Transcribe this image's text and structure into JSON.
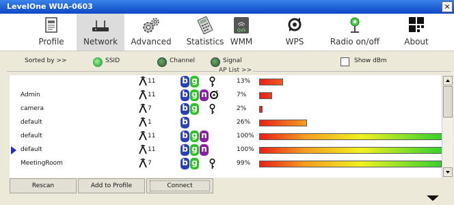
{
  "window": {
    "title": "LevelOne WUA-0603",
    "close_glyph": "×"
  },
  "toolbar": {
    "items": [
      {
        "label": "Profile",
        "icon": "profile-icon"
      },
      {
        "label": "Network",
        "icon": "network-icon",
        "active": true
      },
      {
        "label": "Advanced",
        "icon": "gears-icon"
      },
      {
        "label": "Statistics",
        "icon": "calculator-icon"
      },
      {
        "label": "WMM",
        "icon": "qos-icon",
        "icon_text": "QoS"
      },
      {
        "label": "WPS",
        "icon": "wps-icon"
      },
      {
        "label": "Radio on/off",
        "icon": "radio-icon"
      },
      {
        "label": "About",
        "icon": "about-icon"
      }
    ]
  },
  "sort": {
    "label": "Sorted by >>",
    "options": [
      {
        "label": "SSID",
        "selected": true
      },
      {
        "label": "Channel",
        "selected": false
      },
      {
        "label": "Signal",
        "selected": false
      }
    ],
    "show_dbm": {
      "label": "Show dBm",
      "checked": false
    }
  },
  "ap_list": {
    "header": "AP List >>",
    "rows": [
      {
        "ssid": "",
        "channel": "11",
        "modes": [
          "b",
          "g"
        ],
        "security": "lock",
        "signal": "13%",
        "signal_value": 13
      },
      {
        "ssid": "Admin",
        "channel": "11",
        "modes": [
          "b",
          "g",
          "n"
        ],
        "security": "wps",
        "signal": "7%",
        "signal_value": 7
      },
      {
        "ssid": "camera",
        "channel": "7",
        "modes": [
          "b",
          "g"
        ],
        "security": "lock",
        "signal": "2%",
        "signal_value": 2
      },
      {
        "ssid": "default",
        "channel": "1",
        "modes": [
          "b"
        ],
        "security": "",
        "signal": "26%",
        "signal_value": 26
      },
      {
        "ssid": "default",
        "channel": "11",
        "modes": [
          "b",
          "g",
          "n"
        ],
        "security": "",
        "signal": "100%",
        "signal_value": 100
      },
      {
        "ssid": "default",
        "channel": "11",
        "modes": [
          "b",
          "g",
          "n"
        ],
        "security": "",
        "signal": "100%",
        "signal_value": 100,
        "selected": true
      },
      {
        "ssid": "MeetingRoom",
        "channel": "7",
        "modes": [
          "b",
          "g"
        ],
        "security": "lock",
        "signal": "99%",
        "signal_value": 99
      }
    ]
  },
  "buttons": {
    "rescan": "Rescan",
    "add_to_profile": "Add to Profile",
    "connect": "Connect"
  },
  "colors": {
    "titlebar": "#0d47c6",
    "mode_b": "#2a3fb8",
    "mode_g": "#2fc024",
    "mode_n": "#8a1fa4",
    "signal_low": "#e8201a",
    "signal_high": "#2fd02f"
  }
}
